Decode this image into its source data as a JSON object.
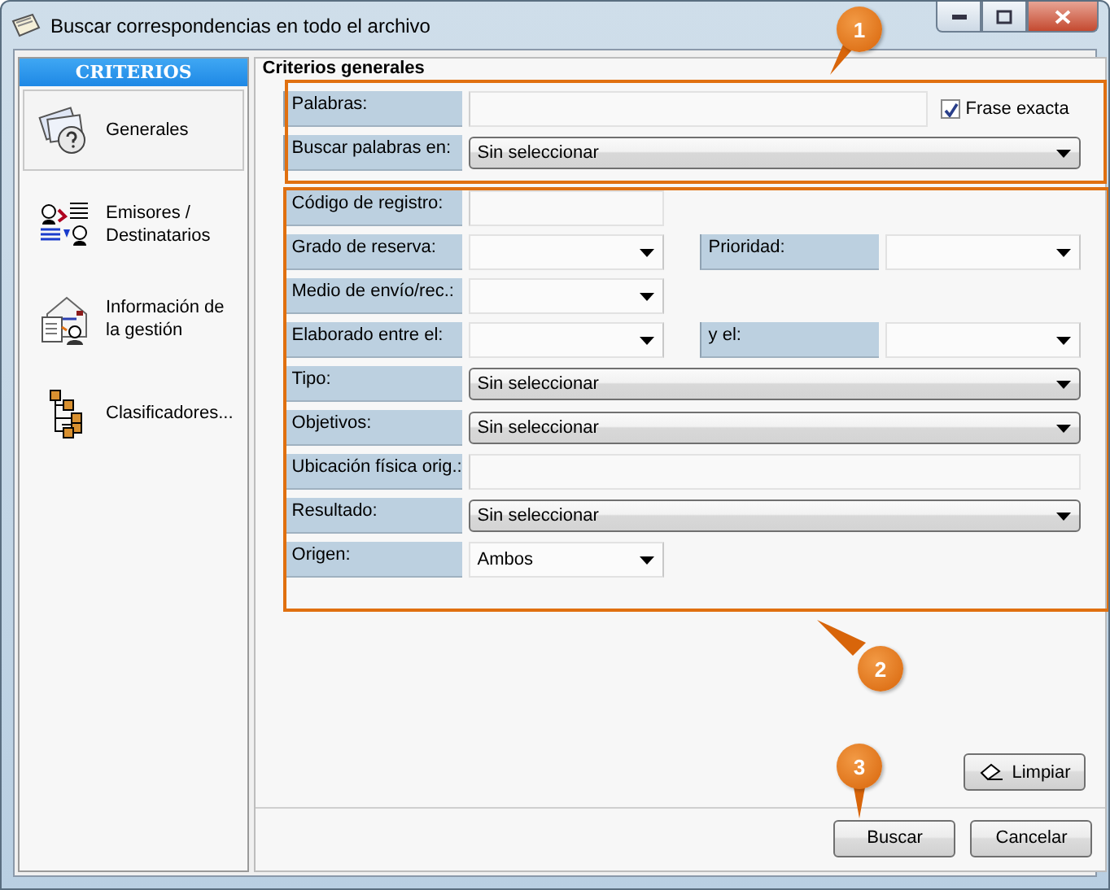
{
  "window": {
    "title": "Buscar correspondencias en todo el archivo"
  },
  "sidebar": {
    "header": "CRITERIOS",
    "items": [
      {
        "label": "Generales",
        "kind": "generales",
        "selected": true
      },
      {
        "label": "Emisores / Destinatarios",
        "kind": "emisores",
        "selected": false
      },
      {
        "label": "Información de la gestión",
        "kind": "gestion",
        "selected": false
      },
      {
        "label": "Clasificadores...",
        "kind": "clasificadores",
        "selected": false
      }
    ]
  },
  "section_title": "Criterios generales",
  "groups": [
    {
      "callout": "1",
      "rows": [
        {
          "fields": [
            {
              "label": "Palabras:",
              "kind": "text"
            }
          ],
          "checkbox": {
            "label": "Frase exacta",
            "checked": true
          }
        },
        {
          "fields": [
            {
              "label": "Buscar palabras en:",
              "kind": "combo",
              "value": "Sin seleccionar"
            }
          ]
        }
      ]
    },
    {
      "callout": "2",
      "rows": [
        {
          "fields": [
            {
              "label": "Código de registro:",
              "kind": "short-text"
            }
          ]
        },
        {
          "fields": [
            {
              "label": "Grado de reserva:",
              "kind": "short-combo"
            },
            {
              "label": "Prioridad:",
              "kind": "short-combo"
            }
          ]
        },
        {
          "fields": [
            {
              "label": "Medio de envío/rec.:",
              "kind": "short-combo"
            }
          ]
        },
        {
          "fields": [
            {
              "label": "Elaborado entre el:",
              "kind": "short-combo"
            },
            {
              "label": "y el:",
              "kind": "short-combo"
            }
          ]
        },
        {
          "fields": [
            {
              "label": "Tipo:",
              "kind": "combo",
              "value": "Sin seleccionar"
            }
          ]
        },
        {
          "fields": [
            {
              "label": "Objetivos:",
              "kind": "combo",
              "value": "Sin seleccionar"
            }
          ]
        },
        {
          "fields": [
            {
              "label": "Ubicación física orig.:",
              "kind": "text"
            }
          ]
        },
        {
          "fields": [
            {
              "label": "Resultado:",
              "kind": "combo",
              "value": "Sin seleccionar"
            }
          ]
        },
        {
          "fields": [
            {
              "label": "Origen:",
              "kind": "short-combo",
              "value": "Ambos"
            }
          ]
        }
      ]
    }
  ],
  "clear_button": "Limpiar",
  "buttons": [
    {
      "label": "Buscar",
      "callout": "3"
    },
    {
      "label": "Cancelar"
    }
  ]
}
